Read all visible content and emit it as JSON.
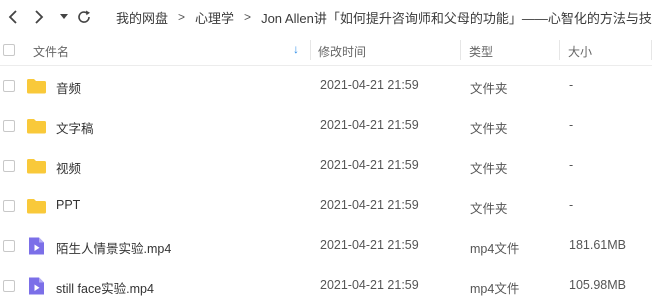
{
  "breadcrumb": [
    "我的网盘",
    "心理学",
    "Jon Allen讲「如何提升咨询师和父母的功能」——心智化的方法与技术 ..."
  ],
  "breadcrumb_separator": ">",
  "columns": {
    "name": "文件名",
    "modified": "修改时间",
    "type": "类型",
    "size": "大小"
  },
  "sort_indicator": "↓",
  "colors": {
    "folder": "#F9C93A",
    "video": "#7B6FE8",
    "sort_arrow": "#2C8CE8"
  },
  "files": [
    {
      "name": "音频",
      "modified": "2021-04-21 21:59",
      "type": "文件夹",
      "size": "-",
      "icon": "folder-icon"
    },
    {
      "name": "文字稿",
      "modified": "2021-04-21 21:59",
      "type": "文件夹",
      "size": "-",
      "icon": "folder-icon"
    },
    {
      "name": "视频",
      "modified": "2021-04-21 21:59",
      "type": "文件夹",
      "size": "-",
      "icon": "folder-icon"
    },
    {
      "name": "PPT",
      "modified": "2021-04-21 21:59",
      "type": "文件夹",
      "size": "-",
      "icon": "folder-icon"
    },
    {
      "name": "陌生人情景实验.mp4",
      "modified": "2021-04-21 21:59",
      "type": "mp4文件",
      "size": "181.61MB",
      "icon": "video-file-icon"
    },
    {
      "name": "still face实验.mp4",
      "modified": "2021-04-21 21:59",
      "type": "mp4文件",
      "size": "105.98MB",
      "icon": "video-file-icon"
    }
  ]
}
